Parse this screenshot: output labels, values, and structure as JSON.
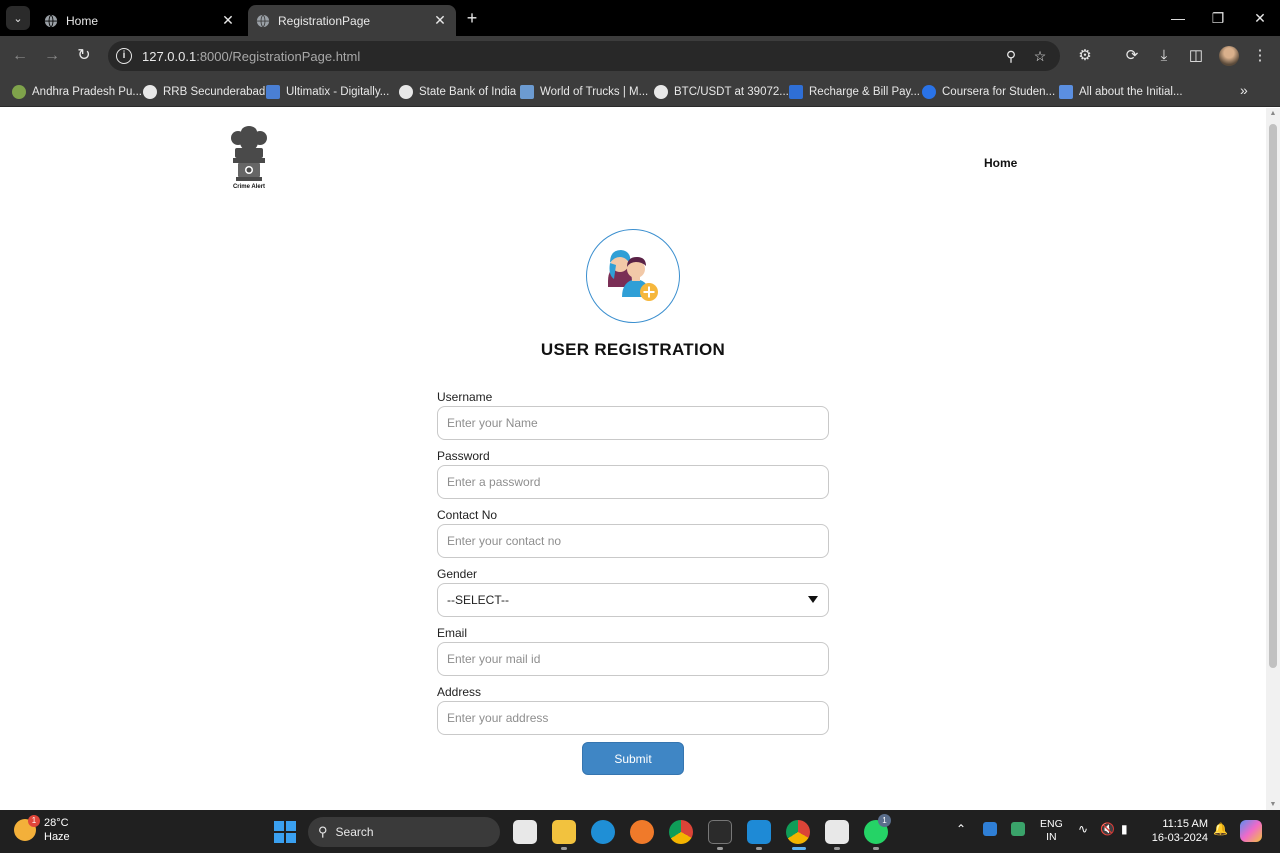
{
  "browser": {
    "tabs": [
      {
        "title": "Home",
        "active": false
      },
      {
        "title": "RegistrationPage",
        "active": true
      }
    ],
    "url_host": "127.0.0.1",
    "url_rest": ":8000/RegistrationPage.html",
    "bookmarks": [
      "Andhra Pradesh Pu...",
      "RRB Secunderabad",
      "Ultimatix - Digitally...",
      "State Bank of India",
      "World of Trucks | M...",
      "BTC/USDT at 39072....",
      "Recharge & Bill Pay...",
      "Coursera for Studen...",
      "All about the Initial..."
    ]
  },
  "header": {
    "logo_caption": "Crime Alert",
    "nav_home": "Home"
  },
  "registration": {
    "title": "USER REGISTRATION",
    "fields": {
      "username": {
        "label": "Username",
        "placeholder": "Enter your Name"
      },
      "password": {
        "label": "Password",
        "placeholder": "Enter a password"
      },
      "contact": {
        "label": "Contact No",
        "placeholder": "Enter your contact no"
      },
      "gender": {
        "label": "Gender",
        "selected": "--SELECT--"
      },
      "email": {
        "label": "Email",
        "placeholder": "Enter your mail id"
      },
      "address": {
        "label": "Address",
        "placeholder": "Enter your address"
      }
    },
    "submit_label": "Submit"
  },
  "taskbar": {
    "weather_temp": "28°C",
    "weather_desc": "Haze",
    "weather_badge": "1",
    "search_label": "Search",
    "whatsapp_badge": "1",
    "lang_line1": "ENG",
    "lang_line2": "IN",
    "time": "11:15 AM",
    "date": "16-03-2024"
  },
  "colors": {
    "accent": "#3f86c5",
    "avatar_ring": "#3b8fcf",
    "browser_chrome": "#3c3c3c"
  }
}
